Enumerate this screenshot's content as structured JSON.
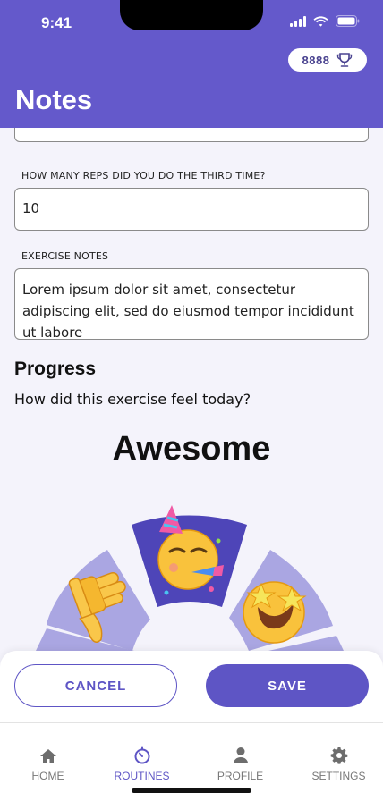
{
  "status": {
    "time": "9:41"
  },
  "header": {
    "title": "Notes",
    "points": "8888"
  },
  "form": {
    "third_reps_label": "HOW MANY REPS DID YOU DO THE THIRD TIME?",
    "third_reps_value": "10",
    "notes_label": "EXERCISE NOTES",
    "notes_value": "Lorem ipsum dolor sit amet, consectetur adipiscing elit, sed do eiusmod tempor incididunt ut labore"
  },
  "progress": {
    "title": "Progress",
    "question": "How did this exercise feel today?",
    "selected_mood": "Awesome"
  },
  "actions": {
    "cancel_label": "CANCEL",
    "save_label": "SAVE"
  },
  "tabs": [
    {
      "label": "HOME",
      "icon": "home-icon"
    },
    {
      "label": "ROUTINES",
      "icon": "timer-icon"
    },
    {
      "label": "PROFILE",
      "icon": "person-icon"
    },
    {
      "label": "SETTINGS",
      "icon": "gear-icon"
    }
  ],
  "colors": {
    "primary": "#6459cb",
    "accent": "#5e55c5",
    "wheel_light": "#aaa6e2",
    "wheel_selected": "#4e45b8"
  }
}
